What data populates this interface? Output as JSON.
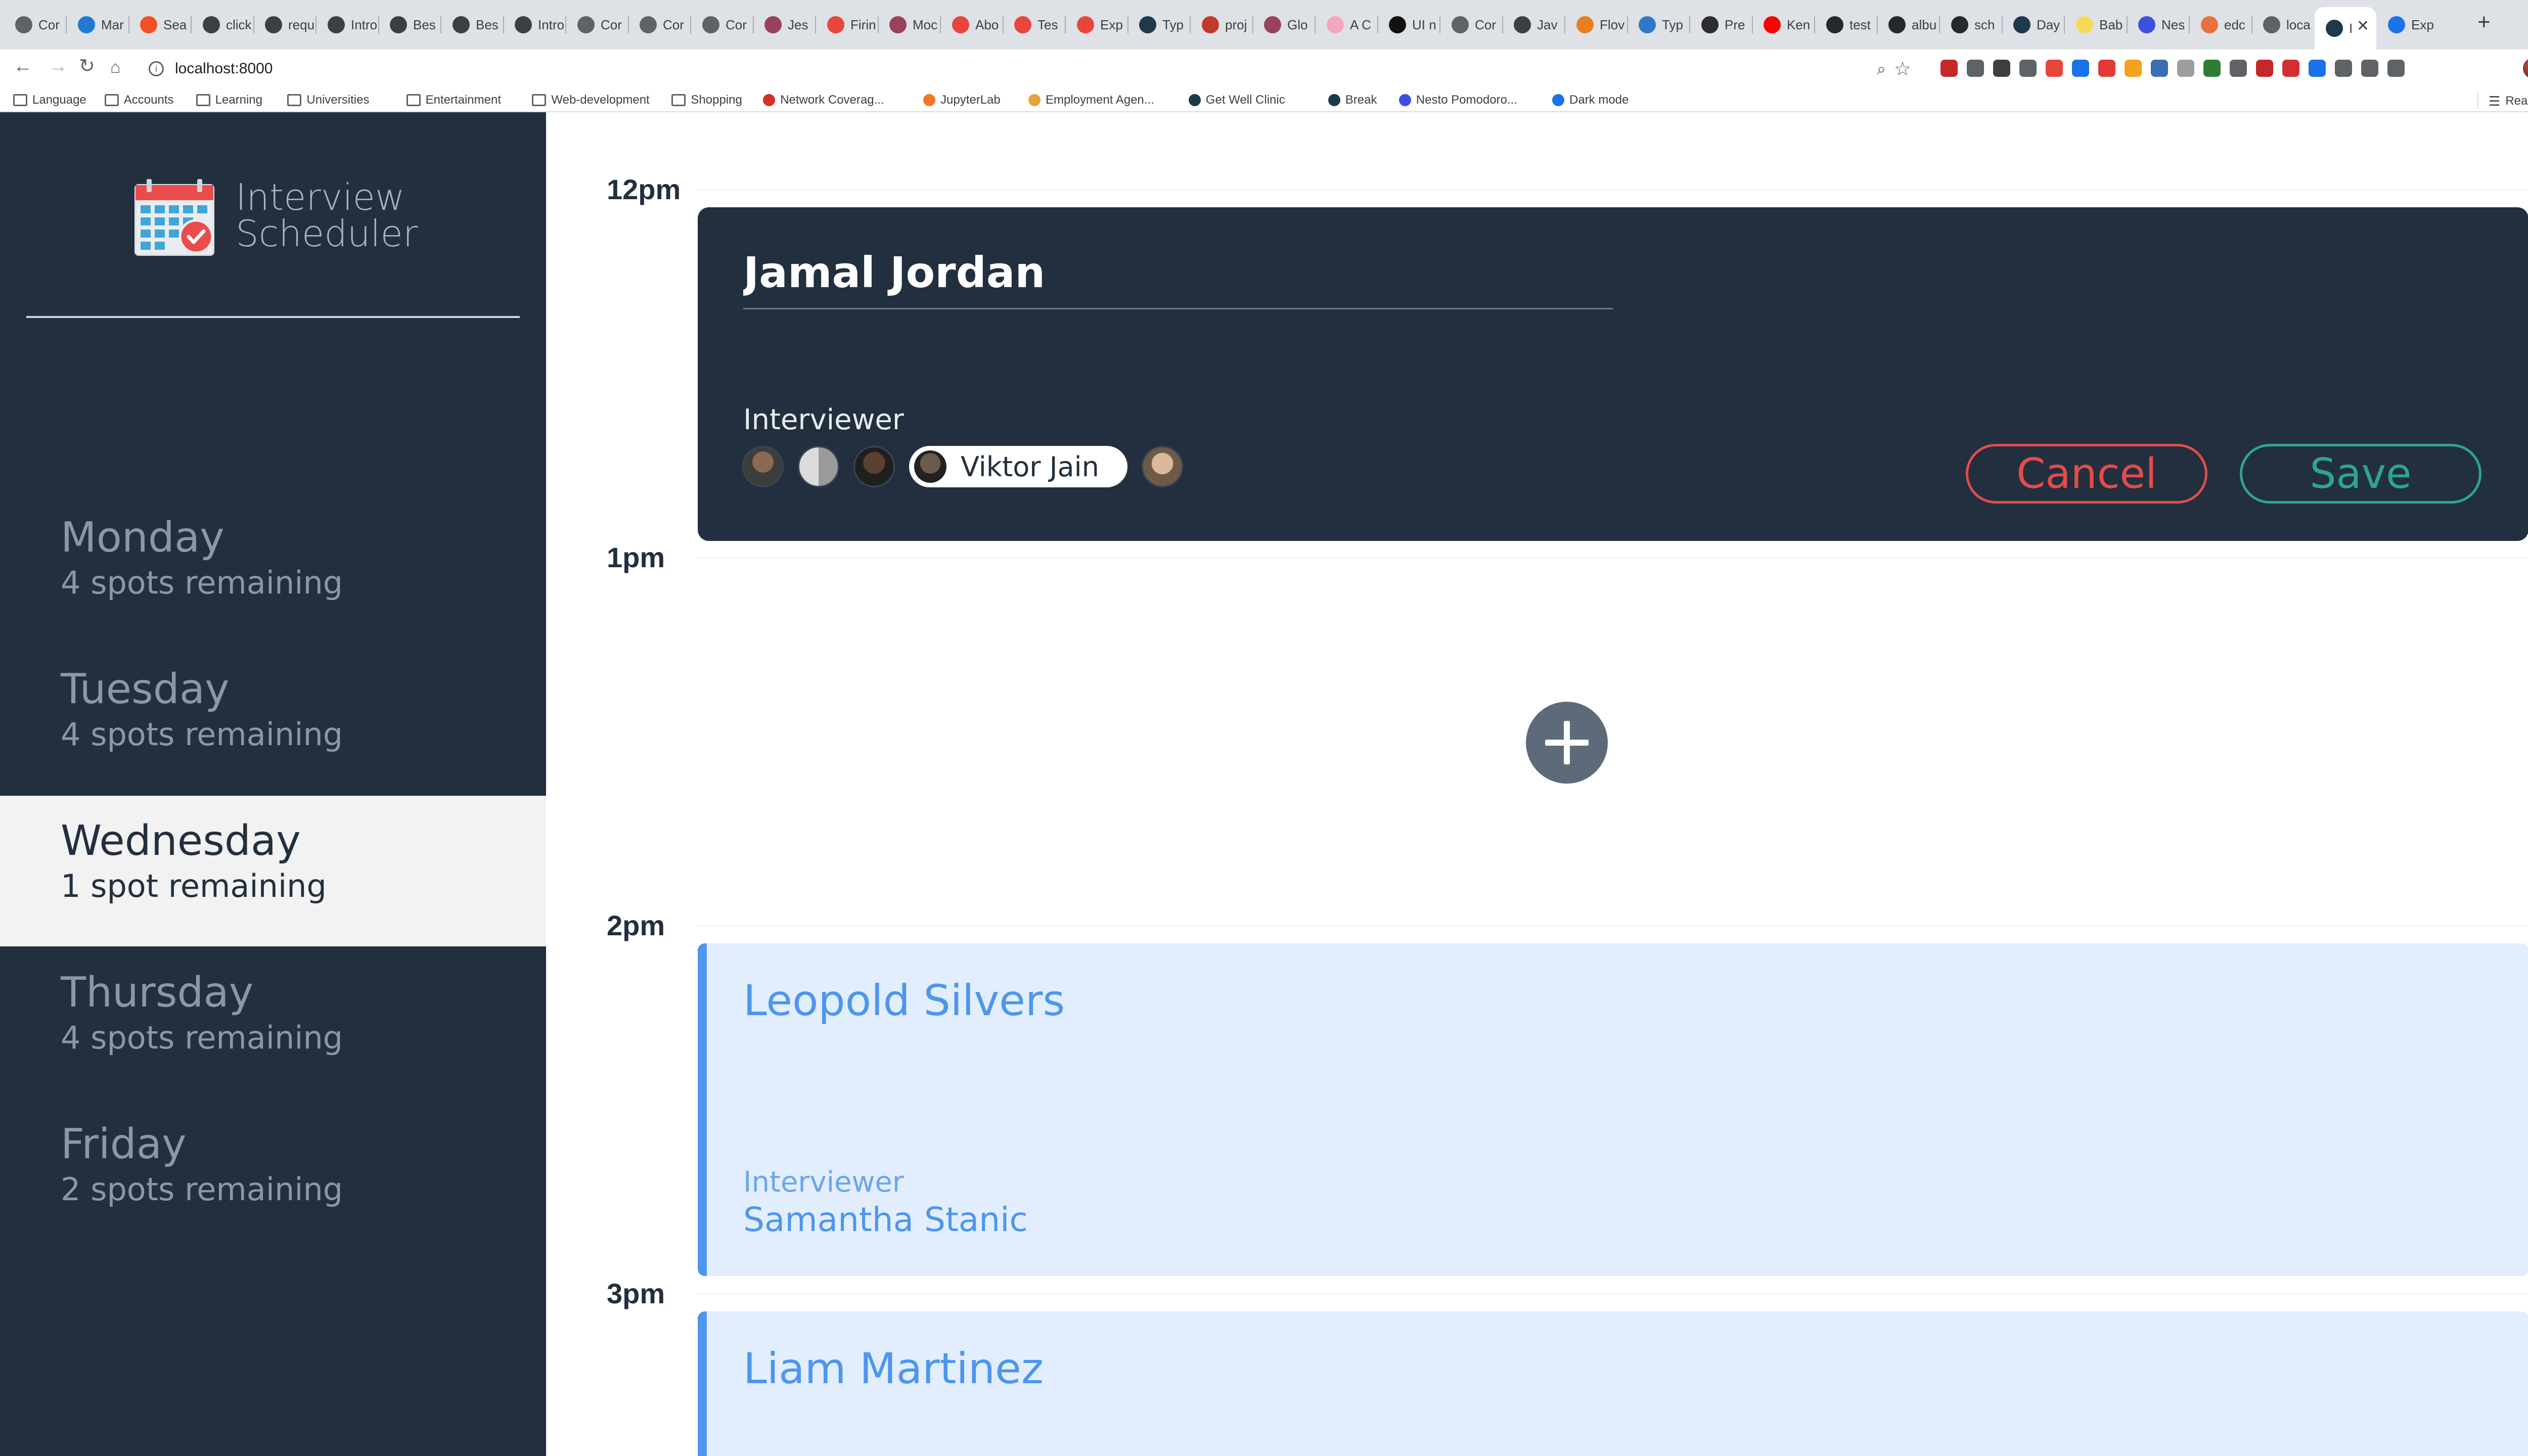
{
  "browser": {
    "tabs": [
      {
        "title": "Cor",
        "color": "#5f6368"
      },
      {
        "title": "Mar",
        "color": "#1f7ad6"
      },
      {
        "title": "Sea",
        "color": "#f25022"
      },
      {
        "title": "click",
        "color": "#3c4043"
      },
      {
        "title": "requ",
        "color": "#3c4043"
      },
      {
        "title": "Intro",
        "color": "#3c4043"
      },
      {
        "title": "Bes",
        "color": "#3c4043"
      },
      {
        "title": "Bes",
        "color": "#3c4043"
      },
      {
        "title": "Intro",
        "color": "#3c4043"
      },
      {
        "title": "Cor",
        "color": "#5f6368"
      },
      {
        "title": "Cor",
        "color": "#5f6368"
      },
      {
        "title": "Cor",
        "color": "#5f6368"
      },
      {
        "title": "Jes",
        "color": "#99425b"
      },
      {
        "title": "Firin",
        "color": "#e8453c"
      },
      {
        "title": "Moc",
        "color": "#99425b"
      },
      {
        "title": "Abo",
        "color": "#e8453c"
      },
      {
        "title": "Tes",
        "color": "#e8453c"
      },
      {
        "title": "Exp",
        "color": "#e8453c"
      },
      {
        "title": "Typ",
        "color": "#1e3a4a"
      },
      {
        "title": "proj",
        "color": "#c0392b"
      },
      {
        "title": "Glo",
        "color": "#99425b"
      },
      {
        "title": "A C",
        "color": "#f4a6c0"
      },
      {
        "title": "UI n",
        "color": "#111111"
      },
      {
        "title": "Cor",
        "color": "#5f6368"
      },
      {
        "title": "Jav",
        "color": "#3c4043"
      },
      {
        "title": "Flov",
        "color": "#e67e22"
      },
      {
        "title": "Typ",
        "color": "#3178c6"
      },
      {
        "title": "Pre",
        "color": "#2d2d2d"
      },
      {
        "title": "Ken",
        "color": "#ff0000"
      },
      {
        "title": "test",
        "color": "#24292e"
      },
      {
        "title": "albu",
        "color": "#24292e"
      },
      {
        "title": "sch",
        "color": "#24292e"
      },
      {
        "title": "Day",
        "color": "#1e3a4a"
      },
      {
        "title": "Bab",
        "color": "#f5da55"
      },
      {
        "title": "Nes",
        "color": "#3c50e0"
      },
      {
        "title": "edc",
        "color": "#e8703a"
      },
      {
        "title": "loca",
        "color": "#5f6368"
      },
      {
        "title": "I",
        "color": "#1e3a4a",
        "active": true
      },
      {
        "title": "Exp",
        "color": "#1a73e8"
      }
    ],
    "url": "localhost:8000",
    "bookmarks": [
      {
        "label": "Language",
        "type": "folder"
      },
      {
        "label": "Accounts",
        "type": "folder"
      },
      {
        "label": "Learning",
        "type": "folder"
      },
      {
        "label": "Universities",
        "type": "folder"
      },
      {
        "label": "Entertainment",
        "type": "folder"
      },
      {
        "label": "Web-development",
        "type": "folder"
      },
      {
        "label": "Shopping",
        "type": "folder"
      },
      {
        "label": "Network Coverag...",
        "type": "site",
        "color": "#d93025"
      },
      {
        "label": "JupyterLab",
        "type": "site",
        "color": "#f37626"
      },
      {
        "label": "Employment Agen...",
        "type": "site",
        "color": "#e8a33c"
      },
      {
        "label": "Get Well Clinic",
        "type": "site",
        "color": "#1e3a4a"
      },
      {
        "label": "Break",
        "type": "site",
        "color": "#1e3a4a"
      },
      {
        "label": "Nesto Pomodoro...",
        "type": "site",
        "color": "#3c50e0"
      },
      {
        "label": "Dark mode",
        "type": "site",
        "color": "#1a73e8"
      }
    ],
    "reading_list": "Reading List",
    "extension_colors": [
      "#c62828",
      "#5f6368",
      "#3c4043",
      "#5f6368",
      "#e8453c",
      "#1a73e8",
      "#e53935",
      "#f4a21a",
      "#3c6eb4",
      "#9e9e9e",
      "#2e7d32",
      "#5f6368",
      "#c62828",
      "#d32f2f",
      "#1a73e8",
      "#5f6368",
      "#5f6368",
      "#5f6368"
    ]
  },
  "app": {
    "title_line1": "Interview",
    "title_line2": "Scheduler",
    "days": [
      {
        "name": "Monday",
        "spots": "4 spots remaining",
        "selected": false
      },
      {
        "name": "Tuesday",
        "spots": "4 spots remaining",
        "selected": false
      },
      {
        "name": "Wednesday",
        "spots": "1 spot remaining",
        "selected": true
      },
      {
        "name": "Thursday",
        "spots": "4 spots remaining",
        "selected": false
      },
      {
        "name": "Friday",
        "spots": "2 spots remaining",
        "selected": false
      }
    ],
    "hours": [
      "12pm",
      "1pm",
      "2pm",
      "3pm"
    ],
    "form": {
      "student_name": "Jamal Jordan",
      "interviewer_label": "Interviewer",
      "interviewers": [
        {
          "name": "",
          "selected": false
        },
        {
          "name": "",
          "selected": false
        },
        {
          "name": "",
          "selected": false
        },
        {
          "name": "Viktor Jain",
          "selected": true
        },
        {
          "name": "",
          "selected": false
        }
      ],
      "cancel_label": "Cancel",
      "save_label": "Save"
    },
    "add_label": "+",
    "appointments": [
      {
        "student": "Leopold Silvers",
        "interviewer_label": "Interviewer",
        "interviewer": "Samantha Stanic"
      },
      {
        "student": "Liam Martinez"
      }
    ]
  }
}
